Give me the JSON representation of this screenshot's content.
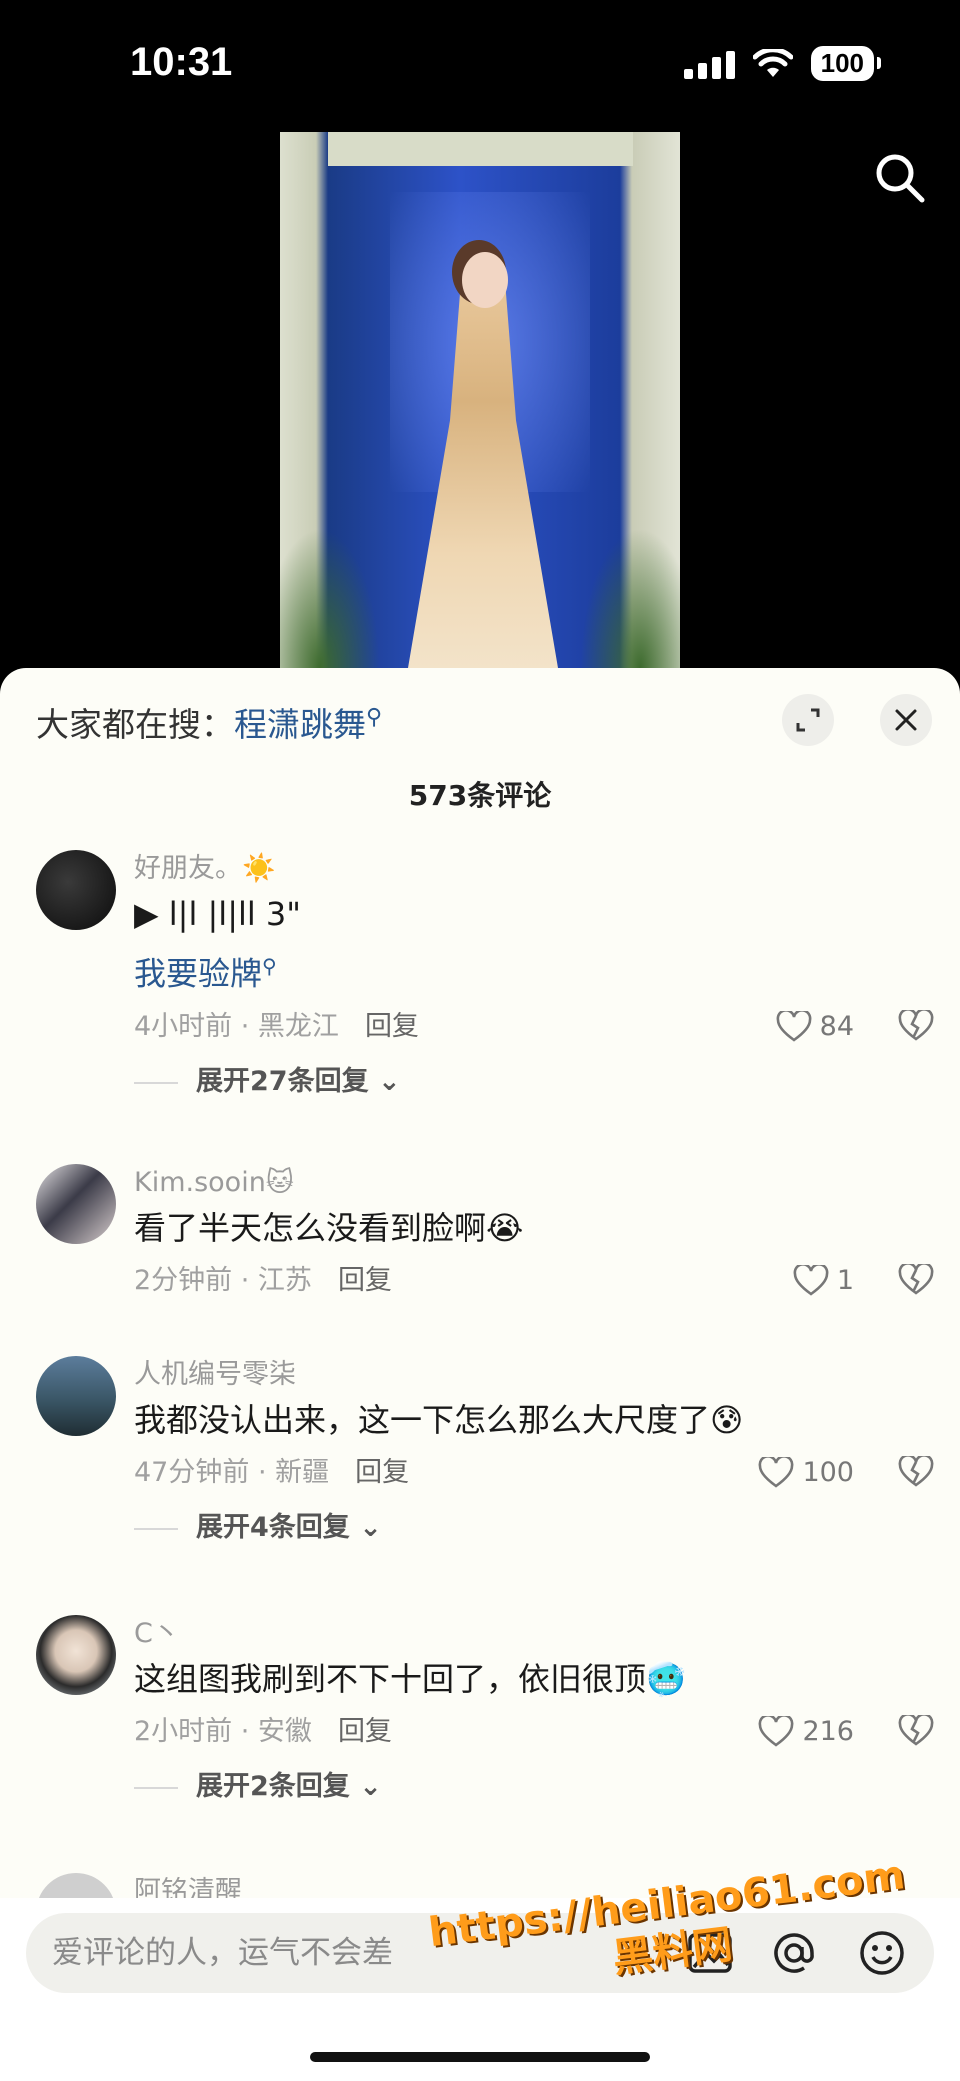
{
  "status": {
    "time": "10:31",
    "battery": "100"
  },
  "sheet": {
    "hot_search_prefix": "大家都在搜：",
    "hot_search_term": "程潇跳舞",
    "comment_count_title": "573条评论"
  },
  "comments": [
    {
      "name": "好朋友。☀️",
      "text": "▶ ⅼ|ⅼ |ⅼ|ⅼⅼ 3\"",
      "link": "我要验牌",
      "meta": "4小时前 · 黑龙江",
      "reply": "回复",
      "likes": "84",
      "expand": "展开27条回复"
    },
    {
      "name": "Kim.sooin🐱",
      "text": "看了半天怎么没看到脸啊😭",
      "meta": "2分钟前 · 江苏",
      "reply": "回复",
      "likes": "1"
    },
    {
      "name": "人机编号零柒",
      "text": "我都没认出来，这一下怎么那么大尺度了😰",
      "meta": "47分钟前 · 新疆",
      "reply": "回复",
      "likes": "100",
      "expand": "展开4条回复"
    },
    {
      "name": "C丶",
      "text": "这组图我刷到不下十回了，依旧很顶🥶",
      "meta": "2小时前 · 安徽",
      "reply": "回复",
      "likes": "216",
      "expand": "展开2条回复"
    },
    {
      "name": "阿铭清醒"
    }
  ],
  "input": {
    "placeholder": "爱评论的人，运气不会差"
  },
  "watermark": {
    "line1": "https://heiliao61.com",
    "line2": "黑料网"
  },
  "colors": {
    "link_blue": "#2a5890",
    "sheet_bg": "#fdfdf7",
    "watermark_orange": "#ff9c1a"
  }
}
